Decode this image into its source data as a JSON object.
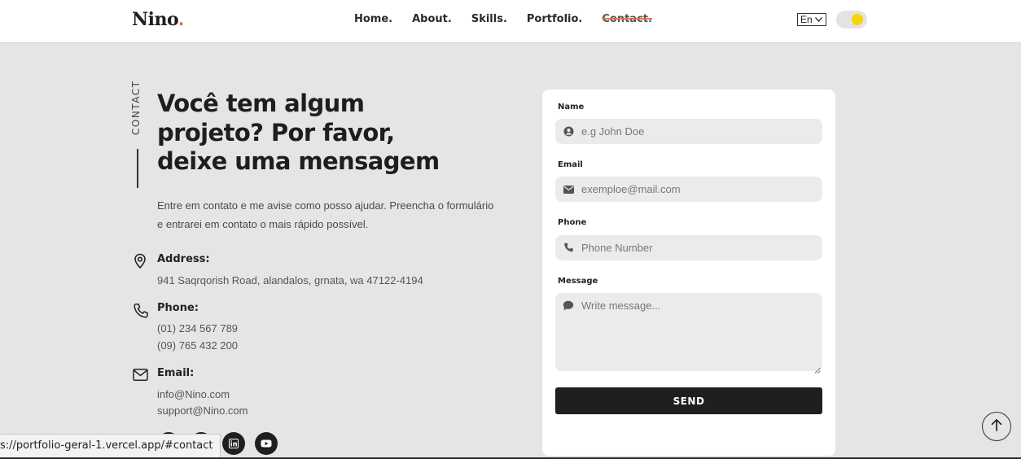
{
  "header": {
    "logo": "Nino",
    "logo_dot": ".",
    "nav": [
      "Home.",
      "About.",
      "Skills.",
      "Portfolio.",
      "Contact."
    ],
    "active_nav": "Contact.",
    "language": "En",
    "theme_toggle": "light-mode-sun"
  },
  "contact": {
    "section_label": "CONTACT",
    "heading_lines": [
      "Você tem algum",
      "projeto? Por favor,",
      "deixe uma mensagem"
    ],
    "intro_lines": [
      "Entre em contato e me avise como posso ajudar. Preencha o formulário",
      "e entrarei em contato o mais rápido possível."
    ],
    "address": {
      "title": "Address:",
      "value": "941 Saqrqorish Road, alandalos, grnata, wa 47122-4194",
      "icon": "map-pin-icon"
    },
    "phone": {
      "title": "Phone:",
      "values": [
        "(01) 234 567 789",
        "(09) 765 432 200"
      ],
      "icon": "phone-icon"
    },
    "email": {
      "title": "Email:",
      "values": [
        "info@Nino.com",
        "support@Nino.com"
      ],
      "icon": "envelope-icon"
    },
    "socials": [
      "facebook-icon",
      "twitter-icon",
      "linkedin-icon",
      "youtube-icon"
    ]
  },
  "form": {
    "name": {
      "label": "Name",
      "placeholder": "e.g John Doe",
      "icon": "user-icon"
    },
    "email": {
      "label": "Email",
      "placeholder": "exemploe@mail.com",
      "icon": "envelope-icon"
    },
    "phone": {
      "label": "Phone",
      "placeholder": "Phone Number",
      "icon": "phone-icon"
    },
    "message": {
      "label": "Message",
      "placeholder": "Write message...",
      "icon": "chat-icon"
    },
    "submit": "SEND"
  },
  "status_bar": "s://portfolio-geral-1.vercel.app/#contact",
  "colors": {
    "accent": "#e8704a",
    "toggle_knob": "#f7d500",
    "dark": "#1f1f1f",
    "page_bg": "#e5e5e5"
  }
}
